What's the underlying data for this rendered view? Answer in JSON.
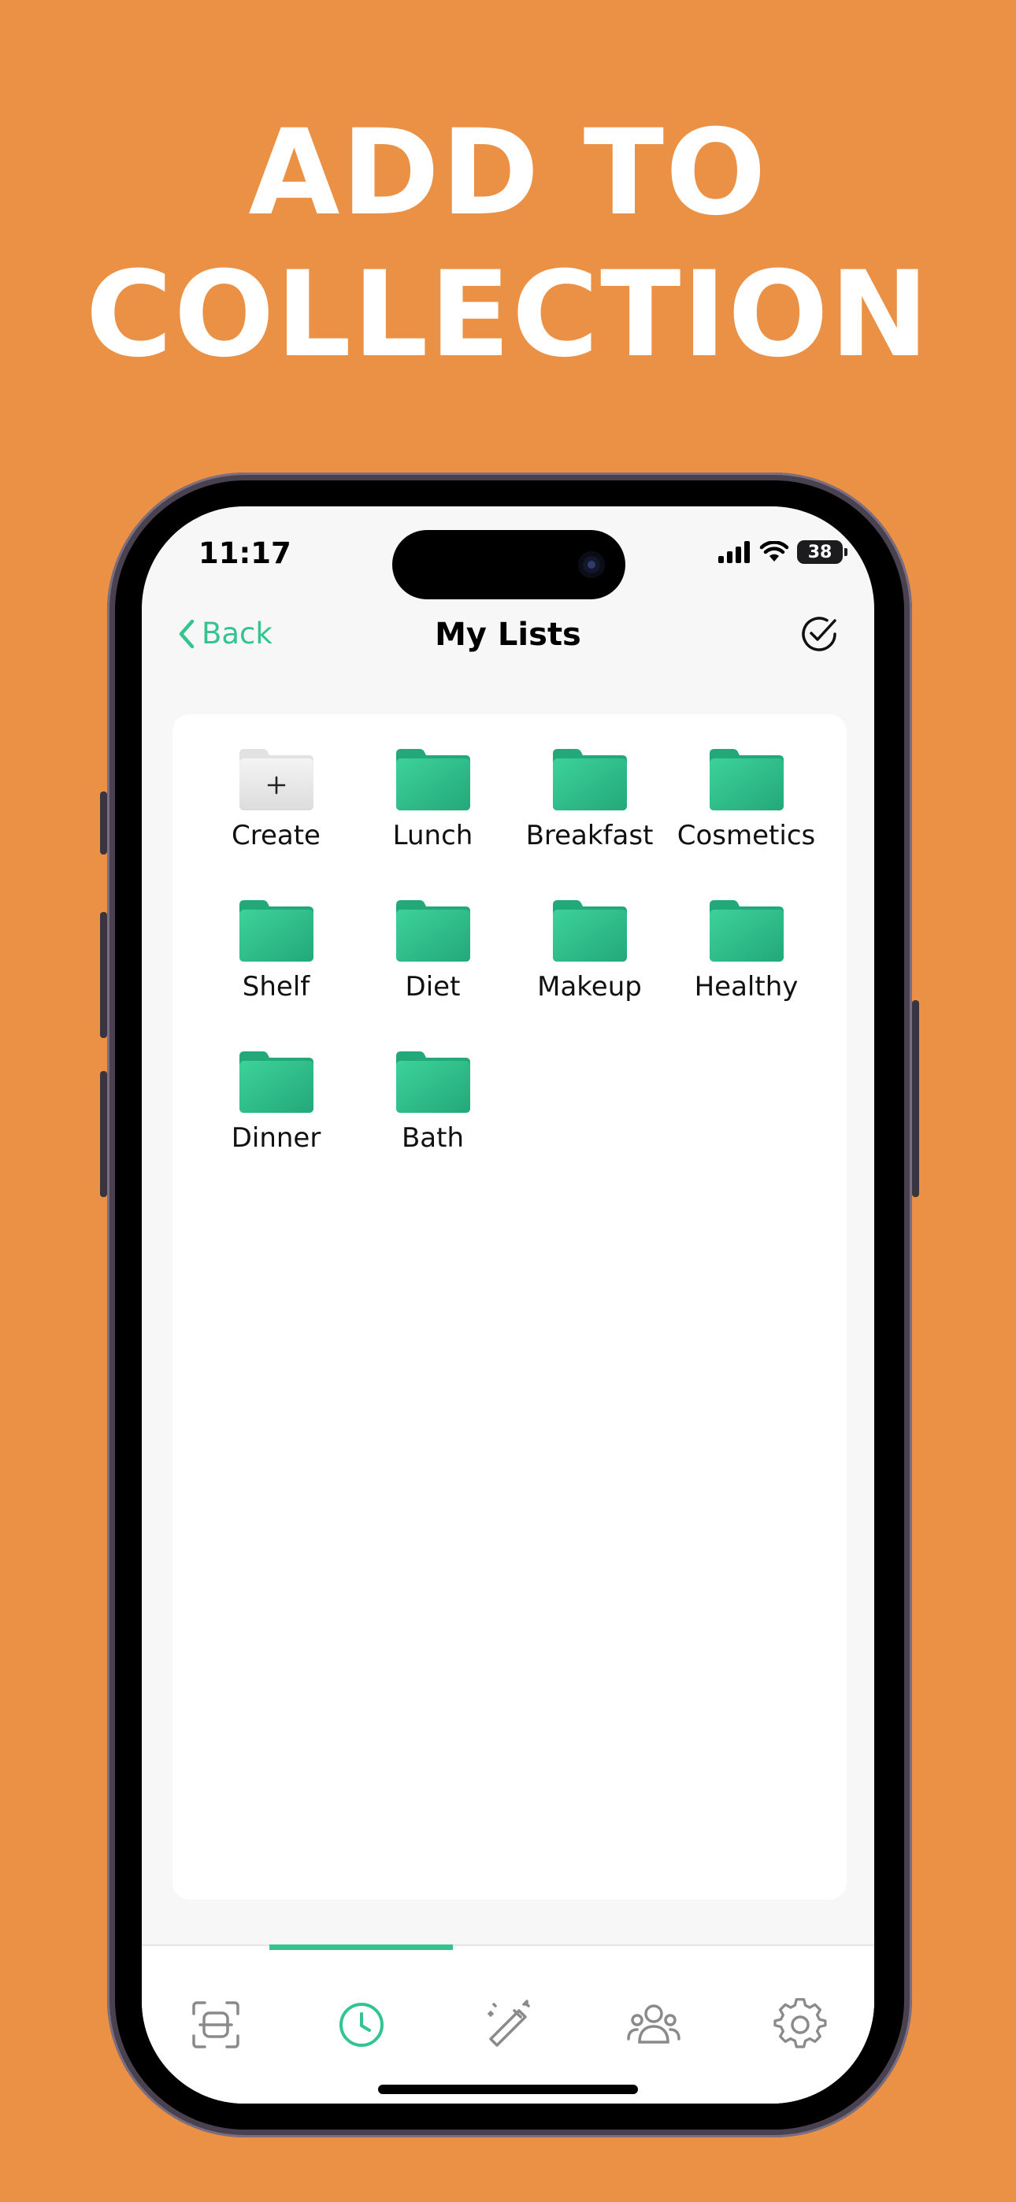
{
  "headline": {
    "line1": "ADD TO",
    "line2": "COLLECTION"
  },
  "status_bar": {
    "time": "11:17",
    "battery": "38"
  },
  "nav": {
    "back_label": "Back",
    "title": "My Lists"
  },
  "folders": [
    {
      "label": "Create",
      "kind": "create"
    },
    {
      "label": "Lunch",
      "kind": "folder"
    },
    {
      "label": "Breakfast",
      "kind": "folder"
    },
    {
      "label": "Cosmetics",
      "kind": "folder"
    },
    {
      "label": "Shelf",
      "kind": "folder"
    },
    {
      "label": "Diet",
      "kind": "folder"
    },
    {
      "label": "Makeup",
      "kind": "folder"
    },
    {
      "label": "Healthy",
      "kind": "folder"
    },
    {
      "label": "Dinner",
      "kind": "folder"
    },
    {
      "label": "Bath",
      "kind": "folder"
    }
  ],
  "tabs": [
    {
      "icon": "scan-icon",
      "selected": false
    },
    {
      "icon": "history-clock-icon",
      "selected": true
    },
    {
      "icon": "magic-wand-icon",
      "selected": false
    },
    {
      "icon": "people-icon",
      "selected": false
    },
    {
      "icon": "settings-gear-icon",
      "selected": false
    }
  ],
  "colors": {
    "background": "#EB9145",
    "accent": "#34C48F",
    "folder_top": "#3DD29A",
    "folder_bottom": "#23A87A"
  }
}
